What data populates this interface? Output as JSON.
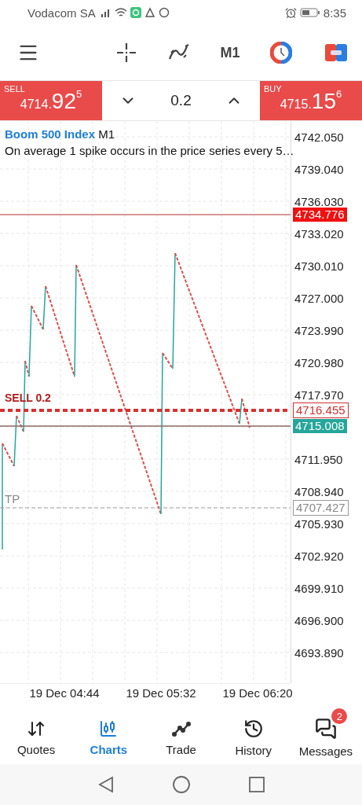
{
  "status_bar": {
    "carrier": "Vodacom SA",
    "time": "8:35"
  },
  "toolbar": {
    "timeframe": "M1"
  },
  "trade_bar": {
    "sell": {
      "label": "SELL",
      "price_main": "4714.",
      "price_big": "92",
      "price_sup": "5"
    },
    "volume": "0.2",
    "buy": {
      "label": "BUY",
      "price_main": "4715.",
      "price_big": "15",
      "price_sup": "6"
    }
  },
  "chart": {
    "symbol": "Boom 500 Index",
    "timeframe": "M1",
    "description": "On average 1 spike occurs in the price series every 5…",
    "price_ticks": [
      "4742.050",
      "4739.040",
      "4736.030",
      "4733.020",
      "4730.010",
      "4727.000",
      "4723.990",
      "4720.980",
      "4717.970",
      "4711.950",
      "4708.940",
      "4705.930",
      "4702.920",
      "4699.910",
      "4696.900",
      "4693.890"
    ],
    "price_tags": [
      {
        "kind": "alert",
        "value": "4734.776"
      },
      {
        "kind": "order",
        "value": "4716.455"
      },
      {
        "kind": "bid",
        "value": "4715.008"
      },
      {
        "kind": "take-profit",
        "value": "4707.427"
      }
    ],
    "order_label": "SELL 0.2",
    "tp_label": "TP",
    "time_labels": [
      "19 Dec 04:44",
      "19 Dec 05:32",
      "19 Dec 06:20"
    ]
  },
  "nav": [
    {
      "kind": "quotes",
      "label": "Quotes",
      "selected": false
    },
    {
      "kind": "charts",
      "label": "Charts",
      "selected": true
    },
    {
      "kind": "trade",
      "label": "Trade",
      "selected": false
    },
    {
      "kind": "history",
      "label": "History",
      "selected": false
    },
    {
      "kind": "messages",
      "label": "Messages",
      "selected": false,
      "badge": "2"
    }
  ]
}
